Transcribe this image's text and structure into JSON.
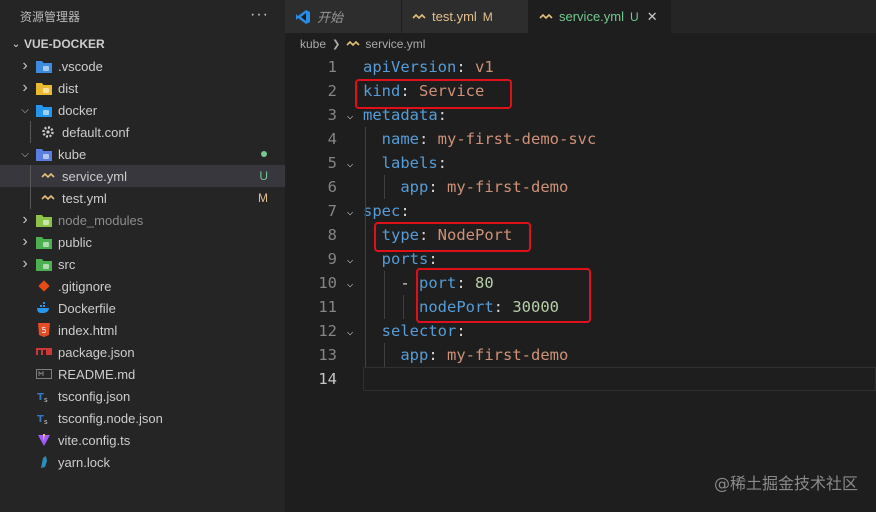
{
  "explorer": {
    "title": "资源管理器",
    "more": "···",
    "project": "VUE-DOCKER",
    "items": [
      {
        "label": ".vscode",
        "kind": "folder",
        "icon": "vscode-folder-icon",
        "expanded": false,
        "color": "#3c8be0"
      },
      {
        "label": "dist",
        "kind": "folder",
        "icon": "dist-folder-icon",
        "expanded": false,
        "color": "#e8b931"
      },
      {
        "label": "docker",
        "kind": "folder",
        "icon": "docker-folder-icon",
        "expanded": true,
        "color": "#2496ed"
      },
      {
        "label": "default.conf",
        "kind": "file",
        "icon": "gear-icon",
        "color": "#cccccc"
      },
      {
        "label": "kube",
        "kind": "folder",
        "icon": "kube-folder-icon",
        "expanded": true,
        "color": "#5a7de0",
        "dot": "#73c991"
      },
      {
        "label": "service.yml",
        "kind": "file",
        "icon": "yaml-icon",
        "color": "#e5c07b",
        "badge": "U",
        "badge_color": "#73c991",
        "selected": true
      },
      {
        "label": "test.yml",
        "kind": "file",
        "icon": "yaml-icon",
        "color": "#e5c07b",
        "badge": "M",
        "badge_color": "#e2c08d"
      },
      {
        "label": "node_modules",
        "kind": "folder",
        "icon": "node-modules-folder-icon",
        "expanded": false,
        "color": "#8bc34a",
        "dim": true
      },
      {
        "label": "public",
        "kind": "folder",
        "icon": "public-folder-icon",
        "expanded": false,
        "color": "#4caf50"
      },
      {
        "label": "src",
        "kind": "folder",
        "icon": "src-folder-icon",
        "expanded": false,
        "color": "#4caf50"
      },
      {
        "label": ".gitignore",
        "kind": "file",
        "icon": "git-icon",
        "color": "#e64a19"
      },
      {
        "label": "Dockerfile",
        "kind": "file",
        "icon": "docker-icon",
        "color": "#2496ed"
      },
      {
        "label": "index.html",
        "kind": "file",
        "icon": "html-icon",
        "color": "#e44d26"
      },
      {
        "label": "package.json",
        "kind": "file",
        "icon": "npm-icon",
        "color": "#cb3837"
      },
      {
        "label": "README.md",
        "kind": "file",
        "icon": "markdown-icon",
        "color": "#7f7f7f"
      },
      {
        "label": "tsconfig.json",
        "kind": "file",
        "icon": "tsconfig-icon",
        "color": "#3178c6"
      },
      {
        "label": "tsconfig.node.json",
        "kind": "file",
        "icon": "tsconfig-icon",
        "color": "#3178c6"
      },
      {
        "label": "vite.config.ts",
        "kind": "file",
        "icon": "vite-icon",
        "color": "#a259ff"
      },
      {
        "label": "yarn.lock",
        "kind": "file",
        "icon": "yarn-icon",
        "color": "#2c8ebb"
      }
    ]
  },
  "tabs": [
    {
      "label": "开始",
      "icon": "vscode-logo-icon",
      "italic": true
    },
    {
      "label": "test.yml",
      "icon": "yaml-icon",
      "badge": "M",
      "badge_color": "#e2c08d"
    },
    {
      "label": "service.yml",
      "icon": "yaml-icon",
      "badge": "U",
      "badge_color": "#73c991",
      "active": true,
      "close": "✕"
    }
  ],
  "breadcrumb": {
    "folder": "kube",
    "file": "service.yml"
  },
  "code": [
    {
      "n": "1",
      "tokens": [
        [
          "k",
          "apiVersion"
        ],
        [
          "p",
          ": "
        ],
        [
          "v",
          "v1"
        ]
      ]
    },
    {
      "n": "2",
      "tokens": [
        [
          "k",
          "kind"
        ],
        [
          "p",
          ": "
        ],
        [
          "v",
          "Service"
        ]
      ]
    },
    {
      "n": "3",
      "fold": true,
      "tokens": [
        [
          "k",
          "metadata"
        ],
        [
          "p",
          ":"
        ]
      ]
    },
    {
      "n": "4",
      "tokens": [
        [
          "p",
          "  "
        ],
        [
          "k",
          "name"
        ],
        [
          "p",
          ": "
        ],
        [
          "v",
          "my-first-demo-svc"
        ]
      ]
    },
    {
      "n": "5",
      "fold": true,
      "tokens": [
        [
          "p",
          "  "
        ],
        [
          "k",
          "labels"
        ],
        [
          "p",
          ":"
        ]
      ]
    },
    {
      "n": "6",
      "tokens": [
        [
          "p",
          "    "
        ],
        [
          "k",
          "app"
        ],
        [
          "p",
          ": "
        ],
        [
          "v",
          "my-first-demo"
        ]
      ]
    },
    {
      "n": "7",
      "fold": true,
      "tokens": [
        [
          "k",
          "spec"
        ],
        [
          "p",
          ":"
        ]
      ]
    },
    {
      "n": "8",
      "tokens": [
        [
          "p",
          "  "
        ],
        [
          "k",
          "type"
        ],
        [
          "p",
          ": "
        ],
        [
          "v",
          "NodePort"
        ]
      ]
    },
    {
      "n": "9",
      "fold": true,
      "tokens": [
        [
          "p",
          "  "
        ],
        [
          "k",
          "ports"
        ],
        [
          "p",
          ":"
        ]
      ]
    },
    {
      "n": "10",
      "fold": true,
      "tokens": [
        [
          "p",
          "    - "
        ],
        [
          "k",
          "port"
        ],
        [
          "p",
          ": "
        ],
        [
          "n",
          "80"
        ]
      ]
    },
    {
      "n": "11",
      "tokens": [
        [
          "p",
          "      "
        ],
        [
          "k",
          "nodePort"
        ],
        [
          "p",
          ": "
        ],
        [
          "n",
          "30000"
        ]
      ]
    },
    {
      "n": "12",
      "fold": true,
      "tokens": [
        [
          "p",
          "  "
        ],
        [
          "k",
          "selector"
        ],
        [
          "p",
          ":"
        ]
      ]
    },
    {
      "n": "13",
      "tokens": [
        [
          "p",
          "    "
        ],
        [
          "k",
          "app"
        ],
        [
          "p",
          ": "
        ],
        [
          "v",
          "my-first-demo"
        ]
      ]
    },
    {
      "n": "14",
      "tokens": [],
      "current": true
    }
  ],
  "watermark": "@稀土掘金技术社区"
}
